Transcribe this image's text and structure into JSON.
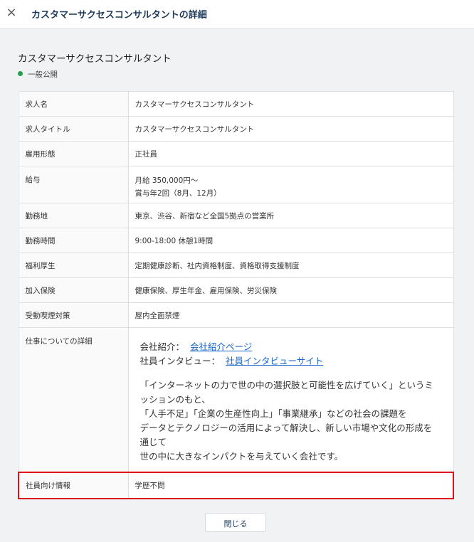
{
  "header": {
    "close_icon": "×",
    "title": "カスタマーサクセスコンサルタントの詳細"
  },
  "job": {
    "title": "カスタマーサクセスコンサルタント",
    "status": "一般公開",
    "status_color": "#22a24a"
  },
  "rows": {
    "job_name": {
      "label": "求人名",
      "value": "カスタマーサクセスコンサルタント"
    },
    "job_title": {
      "label": "求人タイトル",
      "value": "カスタマーサクセスコンサルタント"
    },
    "employment": {
      "label": "雇用形態",
      "value": "正社員"
    },
    "salary": {
      "label": "給与",
      "value1": "月給 350,000円〜",
      "value2": "賞与年2回（8月、12月）"
    },
    "location": {
      "label": "勤務地",
      "value": "東京、渋谷、新宿など全国5拠点の営業所"
    },
    "hours": {
      "label": "勤務時間",
      "value": "9:00-18:00 休憩1時間"
    },
    "welfare": {
      "label": "福利厚生",
      "value": "定期健康診断、社内資格制度、資格取得支援制度"
    },
    "insurance": {
      "label": "加入保険",
      "value": "健康保険、厚生年金、雇用保険、労災保険"
    },
    "smoking": {
      "label": "受動喫煙対策",
      "value": "屋内全面禁煙"
    },
    "details": {
      "label": "仕事についての詳細",
      "company_label": "会社紹介：",
      "company_link": "会社紹介ページ",
      "interview_label": "社員インタビュー：",
      "interview_link": "社員インタビューサイト",
      "lines": [
        "「インターネットの力で世の中の選択肢と可能性を広げていく」というミ",
        "ッションのもと、",
        "「人手不足」「企業の生産性向上」「事業継承」などの社会の課題を",
        "データとテクノロジーの活用によって解決し、新しい市場や文化の形成を",
        "通じて",
        "世の中に大きなインパクトを与えていく会社です。"
      ]
    },
    "employee_info": {
      "label": "社員向け情報",
      "value": "学歴不問"
    }
  },
  "footer": {
    "close_label": "閉じる"
  },
  "colors": {
    "highlight": "#e0101a",
    "link": "#1b66c9",
    "title": "#1d3a5a"
  }
}
